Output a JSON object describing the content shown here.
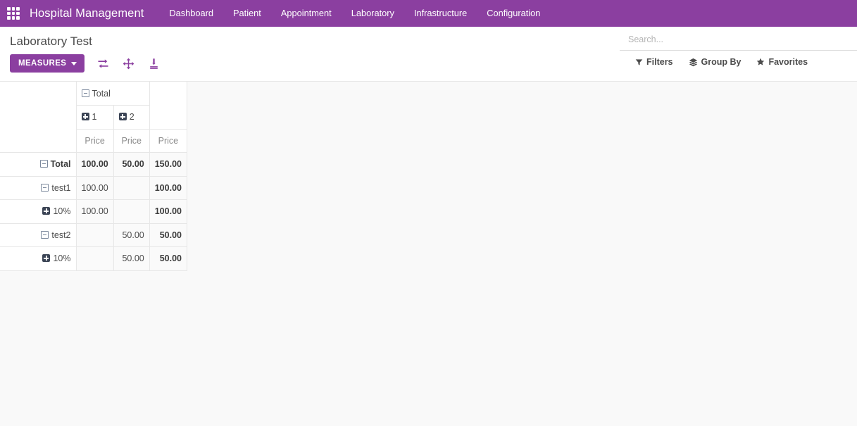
{
  "navbar": {
    "apps_icon": "apps-grid-icon",
    "brand": "Hospital Management",
    "menu": [
      {
        "label": "Dashboard"
      },
      {
        "label": "Patient"
      },
      {
        "label": "Appointment"
      },
      {
        "label": "Laboratory"
      },
      {
        "label": "Infrastructure"
      },
      {
        "label": "Configuration"
      }
    ]
  },
  "control_panel": {
    "breadcrumb": "Laboratory Test",
    "measures_label": "MEASURES",
    "icons": [
      {
        "name": "flip-axis-icon"
      },
      {
        "name": "expand-all-icon"
      },
      {
        "name": "download-xlsx-icon"
      }
    ],
    "search": {
      "value": "",
      "placeholder": "Search..."
    },
    "filter_bar": [
      {
        "name": "filters",
        "label": "Filters",
        "icon": "filter-icon"
      },
      {
        "name": "group-by",
        "label": "Group By",
        "icon": "layers-icon"
      },
      {
        "name": "favorites",
        "label": "Favorites",
        "icon": "star-icon"
      }
    ]
  },
  "pivot": {
    "col_group_header": {
      "label": "Total",
      "state": "expanded",
      "icon": "minus-square-icon"
    },
    "col_subheaders": [
      {
        "label": "1",
        "state": "collapsed",
        "icon": "plus-square-icon"
      },
      {
        "label": "2",
        "state": "collapsed",
        "icon": "plus-square-icon"
      }
    ],
    "measure_headers": [
      "Price",
      "Price",
      "Price"
    ],
    "rows": [
      {
        "label": "Total",
        "indent": 0,
        "state": "expanded",
        "icon": "minus-square-icon",
        "is_total": true,
        "values": [
          "100.00",
          "50.00",
          "150.00"
        ]
      },
      {
        "label": "test1",
        "indent": 1,
        "state": "expanded",
        "icon": "minus-square-icon",
        "is_total": false,
        "values": [
          "100.00",
          "",
          "100.00"
        ]
      },
      {
        "label": "10%",
        "indent": 2,
        "state": "collapsed",
        "icon": "plus-square-icon",
        "is_total": false,
        "values": [
          "100.00",
          "",
          "100.00"
        ]
      },
      {
        "label": "test2",
        "indent": 1,
        "state": "expanded",
        "icon": "minus-square-icon",
        "is_total": false,
        "values": [
          "",
          "50.00",
          "50.00"
        ]
      },
      {
        "label": "10%",
        "indent": 2,
        "state": "collapsed",
        "icon": "plus-square-icon",
        "is_total": false,
        "values": [
          "",
          "50.00",
          "50.00"
        ]
      }
    ]
  },
  "colors": {
    "brand_purple": "#8B3FA0",
    "page_bg": "#f9f9f9",
    "table_border": "#e7e7e7",
    "text": "#4c4c4c",
    "plus_icon_bg": "#3b4455"
  }
}
